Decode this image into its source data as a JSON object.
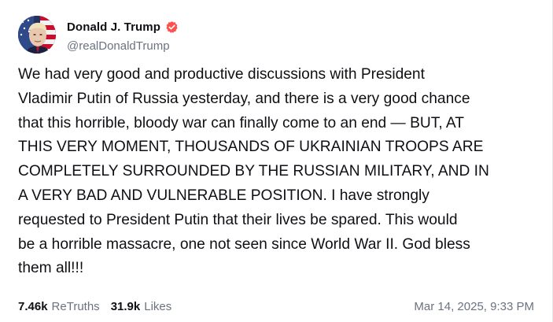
{
  "post": {
    "author": {
      "display_name": "Donald J. Trump",
      "handle": "@realDonaldTrump",
      "verified_icon": "verified-badge-icon",
      "verified_color": "#ff4f4f"
    },
    "text": "We had very good and productive discussions with President\nVladimir Putin of Russia yesterday, and there is a very good chance\nthat this horrible, bloody war can finally come to an end — BUT, AT\nTHIS VERY MOMENT, THOUSANDS OF UKRAINIAN TROOPS ARE\nCOMPLETELY SURROUNDED BY THE RUSSIAN MILITARY, AND IN\nA VERY BAD AND VULNERABLE POSITION. I have strongly\nrequested to President Putin that their lives be spared. This would\nbe a horrible massacre, one not seen since World War II. God bless\nthem all!!!",
    "stats": {
      "retruths_count": "7.46k",
      "retruths_label": "ReTruths",
      "likes_count": "31.9k",
      "likes_label": "Likes"
    },
    "timestamp": "Mar 14, 2025, 9:33 PM"
  },
  "colors": {
    "text_primary": "#0f0f14",
    "text_secondary": "#6b7280",
    "background": "#ffffff"
  }
}
